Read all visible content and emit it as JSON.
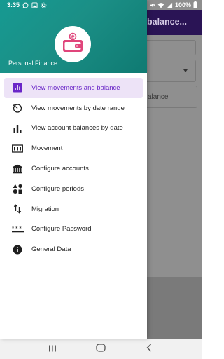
{
  "status_bar": {
    "time": "3:35",
    "battery": "100%",
    "icons": [
      "whatsapp-icon",
      "photo-icon",
      "settings-icon",
      "mute-icon",
      "wifi-icon",
      "signal-icon",
      "battery-icon"
    ]
  },
  "background_app": {
    "title": "balance..."
  },
  "drawer": {
    "logo_icon": "wallet-icon",
    "app_name": "Personal Finance",
    "items": [
      {
        "label": "View movements and balance",
        "icon": "bar-chart-icon",
        "active": true
      },
      {
        "label": "View movements by date range",
        "icon": "timer-icon",
        "active": false
      },
      {
        "label": "View account balances by date",
        "icon": "bar-chart-icon",
        "active": false
      },
      {
        "label": "Movement",
        "icon": "movement-icon",
        "active": false
      },
      {
        "label": "Configure accounts",
        "icon": "bank-icon",
        "active": false
      },
      {
        "label": "Configure periods",
        "icon": "category-icon",
        "active": false
      },
      {
        "label": "Migration",
        "icon": "swap-vert-icon",
        "active": false
      },
      {
        "label": "Configure Password",
        "icon": "password-icon",
        "active": false
      },
      {
        "label": "General Data",
        "icon": "info-icon",
        "active": false
      }
    ]
  },
  "colors": {
    "drawer_header": "#169a92",
    "active_item_bg": "#ede3f7",
    "active_item_text": "#6a26c8",
    "logo_accent": "#e0457b",
    "app_bar": "#2a1455"
  },
  "nav_bar": {
    "buttons": [
      "recents-icon",
      "home-icon",
      "back-icon"
    ]
  }
}
